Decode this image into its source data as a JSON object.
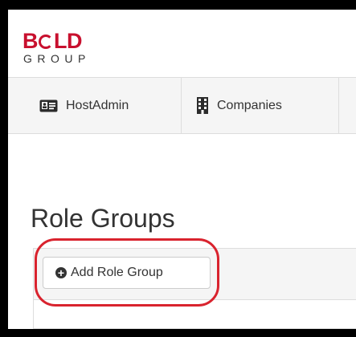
{
  "logo": {
    "word_before": "B",
    "word_after": "LD",
    "subtext": "GROUP"
  },
  "nav": {
    "items": [
      {
        "label": "HostAdmin",
        "icon": "id-card-icon"
      },
      {
        "label": "Companies",
        "icon": "building-icon"
      }
    ]
  },
  "page": {
    "title": "Role Groups"
  },
  "toolbar": {
    "add_label": "Add Role Group",
    "add_icon": "plus-circle-icon"
  },
  "colors": {
    "brand_red": "#c8102e",
    "highlight": "#d9232e",
    "text": "#333333",
    "nav_bg": "#f5f5f5"
  }
}
